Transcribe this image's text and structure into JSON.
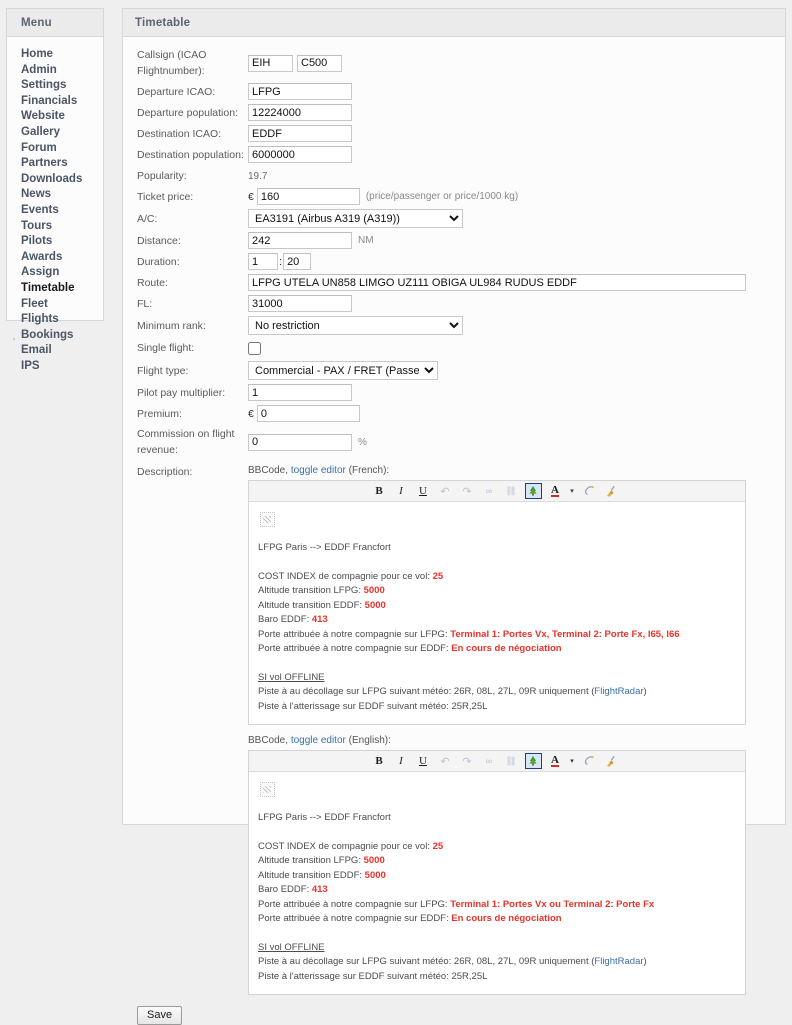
{
  "sidebar": {
    "title": "Menu",
    "items": [
      {
        "label": "Home",
        "active": false
      },
      {
        "label": "Admin",
        "active": false
      },
      {
        "label": "Settings",
        "active": false
      },
      {
        "label": "Financials",
        "active": false
      },
      {
        "label": "Website",
        "active": false
      },
      {
        "label": "Gallery",
        "active": false
      },
      {
        "label": "Forum",
        "active": false
      },
      {
        "label": "Partners",
        "active": false
      },
      {
        "label": "Downloads",
        "active": false
      },
      {
        "label": "News",
        "active": false
      },
      {
        "label": "Events",
        "active": false
      },
      {
        "label": "Tours",
        "active": false
      },
      {
        "label": "Pilots",
        "active": false
      },
      {
        "label": "Awards",
        "active": false
      },
      {
        "label": "Assign",
        "active": false
      },
      {
        "label": "Timetable",
        "active": true
      },
      {
        "label": "Fleet",
        "active": false
      },
      {
        "label": "Flights",
        "active": false
      },
      {
        "label": "Bookings",
        "active": false
      },
      {
        "label": "Email",
        "active": false
      },
      {
        "label": "IPS",
        "active": false
      }
    ]
  },
  "main": {
    "title": "Timetable",
    "form": {
      "callsign": {
        "label": "Callsign (ICAO Flightnumber):",
        "prefix_value": "EIH",
        "number_value": "C500"
      },
      "departure_icao": {
        "label": "Departure ICAO:",
        "value": "LFPG"
      },
      "departure_population": {
        "label": "Departure population:",
        "value": "12224000"
      },
      "destination_icao": {
        "label": "Destination ICAO:",
        "value": "EDDF"
      },
      "destination_population": {
        "label": "Destination population:",
        "value": "6000000"
      },
      "popularity": {
        "label": "Popularity:",
        "value": "19.7"
      },
      "ticket_price": {
        "label": "Ticket price:",
        "currency": "€",
        "value": "160",
        "suffix": "(price/passenger or price/1000 kg)"
      },
      "aircraft": {
        "label": "A/C:",
        "value": "EA3191 (Airbus A319 (A319))",
        "options": [
          "EA3191 (Airbus A319 (A319))"
        ]
      },
      "distance": {
        "label": "Distance:",
        "value": "242",
        "suffix": "NM"
      },
      "duration": {
        "label": "Duration:",
        "hours": "1",
        "separator": ":",
        "minutes": "20"
      },
      "route": {
        "label": "Route:",
        "value": "LFPG UTELA UN858 LIMGO UZ111 OBIGA UL984 RUDUS EDDF"
      },
      "fl": {
        "label": "FL:",
        "value": "31000"
      },
      "minimum_rank": {
        "label": "Minimum rank:",
        "value": "No restriction",
        "options": [
          "No restriction"
        ]
      },
      "single_flight": {
        "label": "Single flight:",
        "checked": false
      },
      "flight_type": {
        "label": "Flight type:",
        "value": "Commercial - PAX / FRET (Passenger)",
        "options": [
          "Commercial - PAX / FRET (Passenger)"
        ]
      },
      "pilot_pay_multiplier": {
        "label": "Pilot pay multiplier:",
        "value": "1"
      },
      "premium": {
        "label": "Premium:",
        "currency": "€",
        "value": "0"
      },
      "commission": {
        "label": "Commission on flight revenue:",
        "value": "0",
        "suffix": "%"
      },
      "description_label": "Description:"
    },
    "editors": [
      {
        "caption_prefix": "BBCode, ",
        "caption_link": "toggle editor",
        "caption_suffix": " (French):",
        "toolbar": [
          {
            "name": "bold-button",
            "glyph": "B",
            "style": "bold",
            "state": "normal"
          },
          {
            "name": "italic-button",
            "glyph": "I",
            "style": "italic",
            "state": "normal"
          },
          {
            "name": "underline-button",
            "glyph": "U",
            "style": "under",
            "state": "normal"
          },
          {
            "name": "undo-button",
            "glyph": "↰",
            "style": "dim",
            "state": "disabled"
          },
          {
            "name": "redo-button",
            "glyph": "↱",
            "style": "dim",
            "state": "disabled"
          },
          {
            "name": "link-button",
            "glyph": "∞",
            "style": "dim",
            "state": "disabled"
          },
          {
            "name": "unlink-button",
            "glyph": "⛓",
            "style": "dim",
            "state": "disabled"
          },
          {
            "name": "insert-image-button",
            "glyph": "🌲",
            "style": "img",
            "state": "selected"
          },
          {
            "name": "font-color-button",
            "glyph": "A",
            "style": "fontcolor",
            "state": "normal"
          },
          {
            "name": "color-dropdown-icon",
            "glyph": "▾",
            "style": "caret",
            "state": "normal"
          },
          {
            "name": "remove-format-button",
            "glyph": "◟",
            "style": "eraser",
            "state": "normal"
          },
          {
            "name": "clean-html-button",
            "glyph": "🧹",
            "style": "broom",
            "state": "normal"
          }
        ],
        "body": {
          "heading": "LFPG Paris --> EDDF Francfort",
          "lines": [
            {
              "text": "COST INDEX de compagnie pour ce vol: ",
              "hl": "25"
            },
            {
              "text": "Altitude transition LFPG: ",
              "hl": "5000"
            },
            {
              "text": "Altitude transition EDDF: ",
              "hl": "5000"
            },
            {
              "text": "Baro EDDF: ",
              "hl": "413"
            },
            {
              "text": "Porte attribuée à notre compagnie sur LFPG: ",
              "hl": "Terminal 1: Portes Vx, Terminal 2: Porte Fx, l65, l66"
            },
            {
              "text": "Porte attribuée à notre compagnie sur EDDF: ",
              "hl": "En cours de négociation"
            }
          ],
          "offline_heading": "SI vol OFFLINE",
          "offline_line1_pre": "Piste à au décollage sur LFPG suivant météo: 26R, 08L, 27L, 09R uniquement (",
          "offline_line1_link": "FlightRadar",
          "offline_line1_post": ")",
          "offline_line2": "Piste à l'atterissage sur EDDF suivant météo: 25R,25L"
        }
      },
      {
        "caption_prefix": "BBCode, ",
        "caption_link": "toggle editor",
        "caption_suffix": " (English):",
        "toolbar": [
          {
            "name": "bold-button",
            "glyph": "B",
            "style": "bold",
            "state": "normal"
          },
          {
            "name": "italic-button",
            "glyph": "I",
            "style": "italic",
            "state": "normal"
          },
          {
            "name": "underline-button",
            "glyph": "U",
            "style": "under",
            "state": "normal"
          },
          {
            "name": "undo-button",
            "glyph": "↰",
            "style": "dim",
            "state": "disabled"
          },
          {
            "name": "redo-button",
            "glyph": "↱",
            "style": "dim",
            "state": "disabled"
          },
          {
            "name": "link-button",
            "glyph": "∞",
            "style": "dim",
            "state": "disabled"
          },
          {
            "name": "unlink-button",
            "glyph": "⛓",
            "style": "dim",
            "state": "disabled"
          },
          {
            "name": "insert-image-button",
            "glyph": "🌲",
            "style": "img",
            "state": "selected"
          },
          {
            "name": "font-color-button",
            "glyph": "A",
            "style": "fontcolor",
            "state": "normal"
          },
          {
            "name": "color-dropdown-icon",
            "glyph": "▾",
            "style": "caret",
            "state": "normal"
          },
          {
            "name": "remove-format-button",
            "glyph": "◟",
            "style": "eraser",
            "state": "normal"
          },
          {
            "name": "clean-html-button",
            "glyph": "🧹",
            "style": "broom",
            "state": "normal"
          }
        ],
        "body": {
          "heading": "LFPG Paris --> EDDF Francfort",
          "lines": [
            {
              "text": "COST INDEX de compagnie pour ce vol: ",
              "hl": "25"
            },
            {
              "text": "Altitude transition LFPG: ",
              "hl": "5000"
            },
            {
              "text": "Altitude transition EDDF: ",
              "hl": "5000"
            },
            {
              "text": "Baro EDDF: ",
              "hl": "413"
            },
            {
              "text": "Porte attribuée à notre compagnie sur LFPG: ",
              "hl": "Terminal 1: Portes Vx ou Terminal 2: Porte Fx"
            },
            {
              "text": "Porte attribuée à notre compagnie sur EDDF: ",
              "hl": "En cours de négociation"
            }
          ],
          "offline_heading": "SI vol OFFLINE",
          "offline_line1_pre": "Piste à au décollage sur LFPG suivant météo: 26R, 08L, 27L, 09R uniquement (",
          "offline_line1_link": "FlightRadar",
          "offline_line1_post": ")",
          "offline_line2": "Piste à l'atterissage sur EDDF suivant météo: 25R,25L"
        }
      }
    ],
    "save_label": "Save"
  },
  "colors": {
    "highlight_red": "#e8332a",
    "link_blue": "#3b6fa8",
    "panel_head": "#ebebeb",
    "page_bg": "#efefef"
  }
}
